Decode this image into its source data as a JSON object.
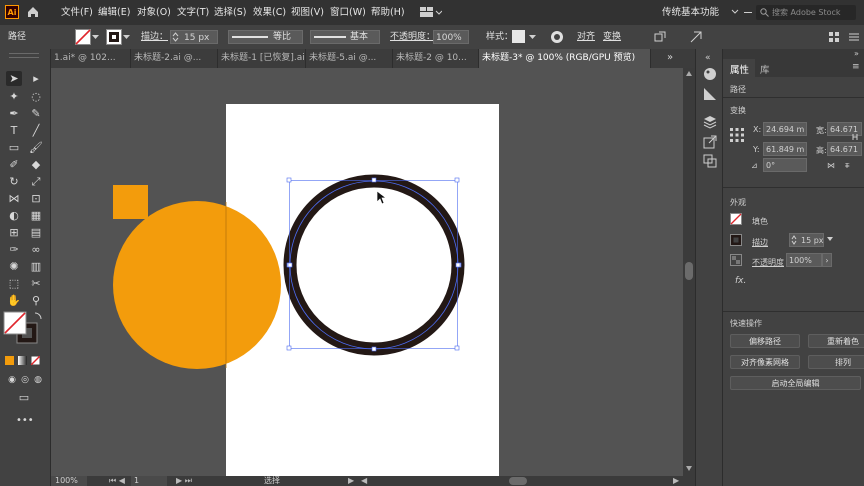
{
  "app": {
    "logo": "Ai",
    "menus": [
      "文件(F)",
      "编辑(E)",
      "对象(O)",
      "文字(T)",
      "选择(S)",
      "效果(C)",
      "视图(V)",
      "窗口(W)",
      "帮助(H)"
    ],
    "workspace": "传统基本功能",
    "search_placeholder": "搜索 Adobe Stock"
  },
  "control": {
    "selection_type": "路径",
    "stroke_label": "描边：",
    "stroke_value": "15 px",
    "profile_label": "等比",
    "brush_label": "基本",
    "opacity_label": "不透明度：",
    "opacity_value": "100%",
    "style_label": "样式：",
    "align_label": "对齐",
    "transform_label": "变换"
  },
  "tabs": [
    {
      "label": "1.ai* @ 102...",
      "active": false
    },
    {
      "label": "未标题-2.ai @...",
      "active": false
    },
    {
      "label": "未标题-1 [已恢复].ai",
      "active": false
    },
    {
      "label": "未标题-5.ai @...",
      "active": false
    },
    {
      "label": "未标题-2 @ 10...",
      "active": false
    },
    {
      "label": "未标题-3* @ 100% (RGB/GPU 预览)",
      "active": true
    }
  ],
  "status": {
    "zoom": "100%",
    "page": "1",
    "mode": "选择"
  },
  "properties": {
    "tab_properties": "属性",
    "tab_libraries": "库",
    "object_type": "路径",
    "transform_title": "变换",
    "x_label": "X:",
    "x_value": "24.694 m",
    "y_label": "Y:",
    "y_value": "61.849 m",
    "w_label": "宽:",
    "w_value": "64.671 m",
    "h_label": "高:",
    "h_value": "64.671 m",
    "angle_value": "0°",
    "appearance_title": "外观",
    "fill_label": "填色",
    "stroke_label": "描边",
    "stroke_value": "15 px",
    "opacity_label": "不透明度",
    "opacity_value": "100%",
    "fx_label": "fx.",
    "quick_actions_title": "快速操作",
    "btn_offset_path": "偏移路径",
    "btn_recolor": "重新着色",
    "btn_pixel_grid": "对齐像素网格",
    "btn_arrange": "排列",
    "btn_global_edit": "启动全局编辑"
  },
  "colors": {
    "orange": "#F39C0C",
    "ring": "#231815",
    "selection": "#4C6BF0"
  }
}
